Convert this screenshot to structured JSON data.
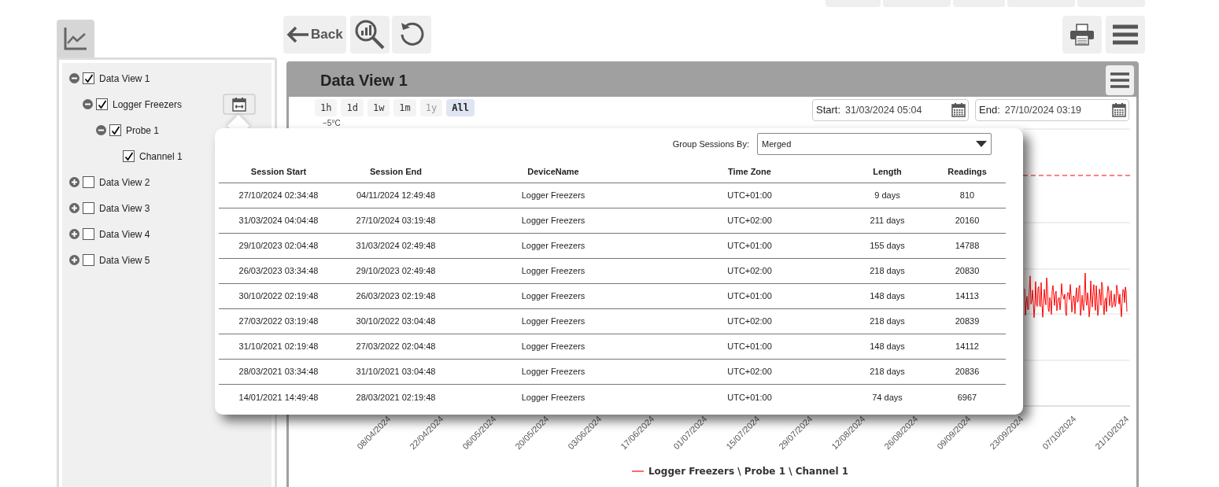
{
  "sidebar": {
    "tree": [
      {
        "label": "Data View 1",
        "expanded": true,
        "checked": true,
        "children": [
          {
            "label": "Logger Freezers",
            "expanded": true,
            "checked": true,
            "sessions_button": true,
            "children": [
              {
                "label": "Probe 1",
                "expanded": true,
                "checked": true,
                "children": [
                  {
                    "label": "Channel 1",
                    "checked": true
                  }
                ]
              }
            ]
          }
        ]
      },
      {
        "label": "Data View 2",
        "expanded": false,
        "checked": false
      },
      {
        "label": "Data View 3",
        "expanded": false,
        "checked": false
      },
      {
        "label": "Data View 4",
        "expanded": false,
        "checked": false
      },
      {
        "label": "Data View 5",
        "expanded": false,
        "checked": false
      }
    ]
  },
  "toolbar": {
    "back_label": "Back"
  },
  "panel": {
    "title": "Data View 1",
    "ranges": [
      {
        "label": "1h",
        "selected": false,
        "disabled": false
      },
      {
        "label": "1d",
        "selected": false,
        "disabled": false
      },
      {
        "label": "1w",
        "selected": false,
        "disabled": false
      },
      {
        "label": "1m",
        "selected": false,
        "disabled": false
      },
      {
        "label": "1y",
        "selected": false,
        "disabled": true
      },
      {
        "label": "All",
        "selected": true,
        "disabled": false
      }
    ],
    "start": {
      "label": "Start:",
      "value": "31/03/2024 05:04"
    },
    "end": {
      "label": "End:",
      "value": "27/10/2024 03:19"
    },
    "y_label": "−5°C",
    "x_labels": [
      "08/04/2024",
      "22/04/2024",
      "06/05/2024",
      "20/05/2024",
      "03/06/2024",
      "17/06/2024",
      "01/07/2024",
      "15/07/2024",
      "29/07/2024",
      "12/08/2024",
      "26/08/2024",
      "09/09/2024",
      "23/09/2024",
      "07/10/2024",
      "21/10/2024"
    ],
    "legend": "Logger Freezers \\ Probe 1 \\ Channel 1"
  },
  "sessions_popup": {
    "group_label": "Group Sessions By:",
    "group_value": "Merged",
    "columns": [
      "Session Start",
      "Session End",
      "DeviceName",
      "Time Zone",
      "Length",
      "Readings"
    ],
    "rows": [
      [
        "27/10/2024 02:34:48",
        "04/11/2024 12:49:48",
        "Logger Freezers",
        "UTC+01:00",
        "9 days",
        "810"
      ],
      [
        "31/03/2024 04:04:48",
        "27/10/2024 03:19:48",
        "Logger Freezers",
        "UTC+02:00",
        "211 days",
        "20160"
      ],
      [
        "29/10/2023 02:04:48",
        "31/03/2024 02:49:48",
        "Logger Freezers",
        "UTC+01:00",
        "155 days",
        "14788"
      ],
      [
        "26/03/2023 03:34:48",
        "29/10/2023 02:49:48",
        "Logger Freezers",
        "UTC+02:00",
        "218 days",
        "20830"
      ],
      [
        "30/10/2022 02:19:48",
        "26/03/2023 02:19:48",
        "Logger Freezers",
        "UTC+01:00",
        "148 days",
        "14113"
      ],
      [
        "27/03/2022 03:19:48",
        "30/10/2022 03:04:48",
        "Logger Freezers",
        "UTC+02:00",
        "218 days",
        "20839"
      ],
      [
        "31/10/2021 02:19:48",
        "27/03/2022 02:04:48",
        "Logger Freezers",
        "UTC+01:00",
        "148 days",
        "14112"
      ],
      [
        "28/03/2021 03:34:48",
        "31/10/2021 03:04:48",
        "Logger Freezers",
        "UTC+02:00",
        "218 days",
        "20836"
      ],
      [
        "14/01/2021 14:49:48",
        "28/03/2021 02:19:48",
        "Logger Freezers",
        "UTC+01:00",
        "74 days",
        "6967"
      ]
    ]
  }
}
